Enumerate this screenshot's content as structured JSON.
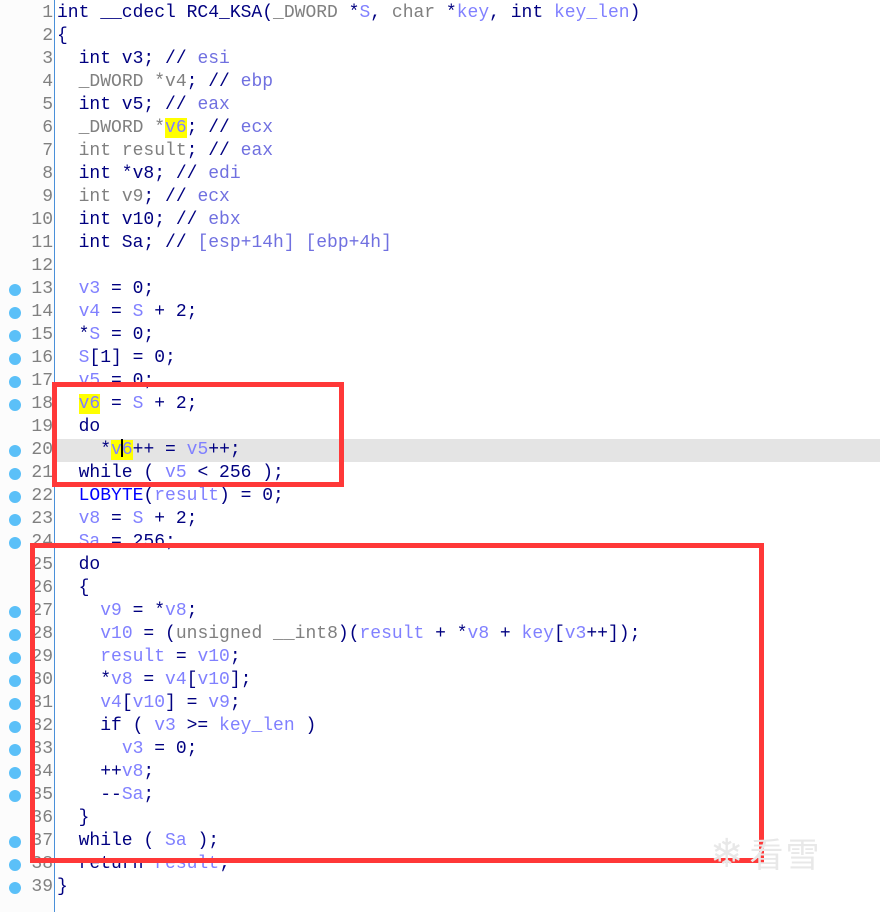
{
  "editor": {
    "highlight_line": 20,
    "highlight_word": "v6",
    "watermark": "看雪",
    "colors": {
      "keyword": "#000080",
      "variable": "#8080ff",
      "type": "#808080",
      "highlight": "#ffff00",
      "annotation_box": "#ff3838",
      "breakpoint_dot": "#5bc0f8"
    },
    "lines": [
      {
        "n": "1",
        "dot": false,
        "tokens": [
          [
            "k",
            "int __cdecl RC4_KSA("
          ],
          [
            "t",
            "_DWORD"
          ],
          [
            "k",
            " *"
          ],
          [
            "v",
            "S"
          ],
          [
            "k",
            ", "
          ],
          [
            "t",
            "char"
          ],
          [
            "k",
            " *"
          ],
          [
            "v",
            "key"
          ],
          [
            "k",
            ", int "
          ],
          [
            "v",
            "key_len"
          ],
          [
            "k",
            ")"
          ]
        ]
      },
      {
        "n": "2",
        "dot": false,
        "tokens": [
          [
            "k",
            "{"
          ]
        ]
      },
      {
        "n": "3",
        "dot": false,
        "tokens": [
          [
            "k",
            "  int v3; // "
          ],
          [
            "c",
            "esi"
          ]
        ]
      },
      {
        "n": "4",
        "dot": false,
        "tokens": [
          [
            "k",
            "  "
          ],
          [
            "t",
            "_DWORD"
          ],
          [
            "t",
            " *v4"
          ],
          [
            "k",
            "; // "
          ],
          [
            "c",
            "ebp"
          ]
        ]
      },
      {
        "n": "5",
        "dot": false,
        "tokens": [
          [
            "k",
            "  int v5; // "
          ],
          [
            "c",
            "eax"
          ]
        ]
      },
      {
        "n": "6",
        "dot": false,
        "tokens": [
          [
            "k",
            "  "
          ],
          [
            "t",
            "_DWORD *"
          ],
          [
            "h",
            "v6"
          ],
          [
            "k",
            "; // "
          ],
          [
            "c",
            "ecx"
          ]
        ]
      },
      {
        "n": "7",
        "dot": false,
        "tokens": [
          [
            "k",
            "  "
          ],
          [
            "t",
            "int result"
          ],
          [
            "k",
            "; // "
          ],
          [
            "c",
            "eax"
          ]
        ]
      },
      {
        "n": "8",
        "dot": false,
        "tokens": [
          [
            "k",
            "  int *v8; // "
          ],
          [
            "c",
            "edi"
          ]
        ]
      },
      {
        "n": "9",
        "dot": false,
        "tokens": [
          [
            "k",
            "  "
          ],
          [
            "t",
            "int v9"
          ],
          [
            "k",
            "; // "
          ],
          [
            "c",
            "ecx"
          ]
        ]
      },
      {
        "n": "10",
        "dot": false,
        "tokens": [
          [
            "k",
            "  int v10; // "
          ],
          [
            "c",
            "ebx"
          ]
        ]
      },
      {
        "n": "11",
        "dot": false,
        "tokens": [
          [
            "k",
            "  int Sa; // "
          ],
          [
            "c",
            "[esp+14h] [ebp+4h]"
          ]
        ]
      },
      {
        "n": "12",
        "dot": false,
        "tokens": []
      },
      {
        "n": "13",
        "dot": true,
        "tokens": [
          [
            "k",
            "  "
          ],
          [
            "v",
            "v3"
          ],
          [
            "k",
            " = 0;"
          ]
        ]
      },
      {
        "n": "14",
        "dot": true,
        "tokens": [
          [
            "k",
            "  "
          ],
          [
            "v",
            "v4"
          ],
          [
            "k",
            " = "
          ],
          [
            "v",
            "S"
          ],
          [
            "k",
            " + 2;"
          ]
        ]
      },
      {
        "n": "15",
        "dot": true,
        "tokens": [
          [
            "k",
            "  *"
          ],
          [
            "v",
            "S"
          ],
          [
            "k",
            " = 0;"
          ]
        ]
      },
      {
        "n": "16",
        "dot": true,
        "tokens": [
          [
            "k",
            "  "
          ],
          [
            "v",
            "S"
          ],
          [
            "k",
            "[1] = 0;"
          ]
        ]
      },
      {
        "n": "17",
        "dot": true,
        "tokens": [
          [
            "k",
            "  "
          ],
          [
            "v",
            "v5"
          ],
          [
            "k",
            " = 0;"
          ]
        ]
      },
      {
        "n": "18",
        "dot": true,
        "tokens": [
          [
            "k",
            "  "
          ],
          [
            "h",
            "v6"
          ],
          [
            "k",
            " = "
          ],
          [
            "v",
            "S"
          ],
          [
            "k",
            " + 2;"
          ]
        ]
      },
      {
        "n": "19",
        "dot": false,
        "tokens": [
          [
            "k",
            "  do"
          ]
        ]
      },
      {
        "n": "20",
        "dot": true,
        "tokens": [
          [
            "k",
            "    *"
          ],
          [
            "hc",
            "v6"
          ],
          [
            "k",
            "++ = "
          ],
          [
            "v",
            "v5"
          ],
          [
            "k",
            "++;"
          ]
        ]
      },
      {
        "n": "21",
        "dot": true,
        "tokens": [
          [
            "k",
            "  while ( "
          ],
          [
            "v",
            "v5"
          ],
          [
            "k",
            " < 256 );"
          ]
        ]
      },
      {
        "n": "22",
        "dot": true,
        "tokens": [
          [
            "k",
            "  "
          ],
          [
            "f",
            "LOBYTE"
          ],
          [
            "k",
            "("
          ],
          [
            "v",
            "result"
          ],
          [
            "k",
            ") = 0;"
          ]
        ]
      },
      {
        "n": "23",
        "dot": true,
        "tokens": [
          [
            "k",
            "  "
          ],
          [
            "v",
            "v8"
          ],
          [
            "k",
            " = "
          ],
          [
            "v",
            "S"
          ],
          [
            "k",
            " + 2;"
          ]
        ]
      },
      {
        "n": "24",
        "dot": true,
        "tokens": [
          [
            "k",
            "  "
          ],
          [
            "v",
            "Sa"
          ],
          [
            "k",
            " = 256;"
          ]
        ]
      },
      {
        "n": "25",
        "dot": false,
        "tokens": [
          [
            "k",
            "  do"
          ]
        ]
      },
      {
        "n": "26",
        "dot": false,
        "tokens": [
          [
            "k",
            "  {"
          ]
        ]
      },
      {
        "n": "27",
        "dot": true,
        "tokens": [
          [
            "k",
            "    "
          ],
          [
            "v",
            "v9"
          ],
          [
            "k",
            " = *"
          ],
          [
            "v",
            "v8"
          ],
          [
            "k",
            ";"
          ]
        ]
      },
      {
        "n": "28",
        "dot": true,
        "tokens": [
          [
            "k",
            "    "
          ],
          [
            "v",
            "v10"
          ],
          [
            "k",
            " = ("
          ],
          [
            "t",
            "unsigned __int8"
          ],
          [
            "k",
            ")("
          ],
          [
            "v",
            "result"
          ],
          [
            "k",
            " + *"
          ],
          [
            "v",
            "v8"
          ],
          [
            "k",
            " + "
          ],
          [
            "v",
            "key"
          ],
          [
            "k",
            "["
          ],
          [
            "v",
            "v3"
          ],
          [
            "k",
            "++]);"
          ]
        ]
      },
      {
        "n": "29",
        "dot": true,
        "tokens": [
          [
            "k",
            "    "
          ],
          [
            "v",
            "result"
          ],
          [
            "k",
            " = "
          ],
          [
            "v",
            "v10"
          ],
          [
            "k",
            ";"
          ]
        ]
      },
      {
        "n": "30",
        "dot": true,
        "tokens": [
          [
            "k",
            "    *"
          ],
          [
            "v",
            "v8"
          ],
          [
            "k",
            " = "
          ],
          [
            "v",
            "v4"
          ],
          [
            "k",
            "["
          ],
          [
            "v",
            "v10"
          ],
          [
            "k",
            "];"
          ]
        ]
      },
      {
        "n": "31",
        "dot": true,
        "tokens": [
          [
            "k",
            "    "
          ],
          [
            "v",
            "v4"
          ],
          [
            "k",
            "["
          ],
          [
            "v",
            "v10"
          ],
          [
            "k",
            "] = "
          ],
          [
            "v",
            "v9"
          ],
          [
            "k",
            ";"
          ]
        ]
      },
      {
        "n": "32",
        "dot": true,
        "tokens": [
          [
            "k",
            "    if ( "
          ],
          [
            "v",
            "v3"
          ],
          [
            "k",
            " >= "
          ],
          [
            "v",
            "key_len"
          ],
          [
            "k",
            " )"
          ]
        ]
      },
      {
        "n": "33",
        "dot": true,
        "tokens": [
          [
            "k",
            "      "
          ],
          [
            "v",
            "v3"
          ],
          [
            "k",
            " = 0;"
          ]
        ]
      },
      {
        "n": "34",
        "dot": true,
        "tokens": [
          [
            "k",
            "    ++"
          ],
          [
            "v",
            "v8"
          ],
          [
            "k",
            ";"
          ]
        ]
      },
      {
        "n": "35",
        "dot": true,
        "tokens": [
          [
            "k",
            "    --"
          ],
          [
            "v",
            "Sa"
          ],
          [
            "k",
            ";"
          ]
        ]
      },
      {
        "n": "36",
        "dot": false,
        "tokens": [
          [
            "k",
            "  }"
          ]
        ]
      },
      {
        "n": "37",
        "dot": true,
        "tokens": [
          [
            "k",
            "  while ( "
          ],
          [
            "v",
            "Sa"
          ],
          [
            "k",
            " );"
          ]
        ]
      },
      {
        "n": "38",
        "dot": true,
        "tokens": [
          [
            "k",
            "  return "
          ],
          [
            "v",
            "result"
          ],
          [
            "k",
            ";"
          ]
        ]
      },
      {
        "n": "39",
        "dot": true,
        "tokens": [
          [
            "k",
            "}"
          ]
        ]
      }
    ]
  }
}
